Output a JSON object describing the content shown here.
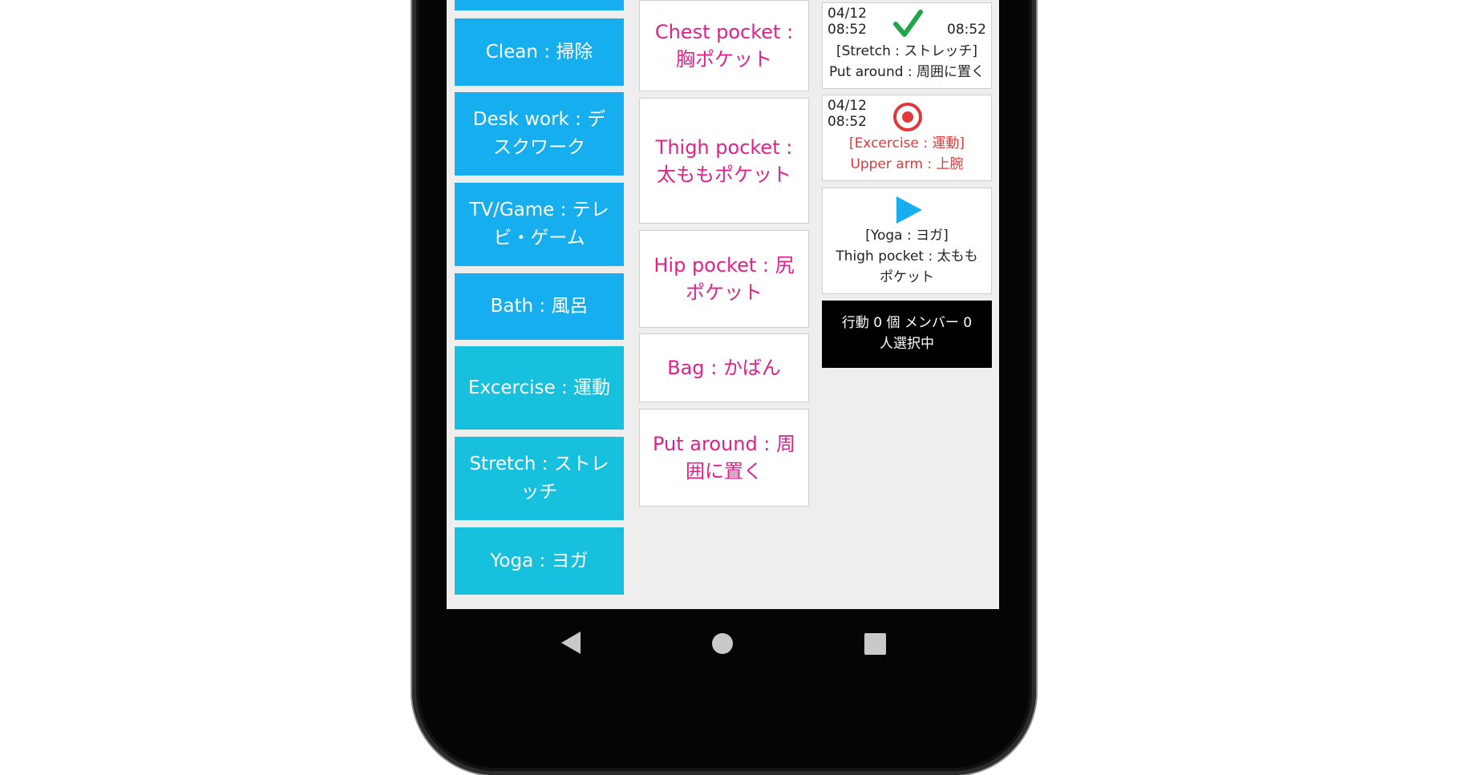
{
  "activities": [
    {
      "label": "",
      "color": "#16aeee"
    },
    {
      "label": "Clean : 掃除",
      "color": "#16aeee"
    },
    {
      "label": "Desk work : デスクワーク",
      "color": "#16aeee"
    },
    {
      "label": "TV/Game : テレビ・ゲーム",
      "color": "#16aeee"
    },
    {
      "label": "Bath : 風呂",
      "color": "#16aeee"
    },
    {
      "label": "Excercise : 運動",
      "color": "#17c0dc"
    },
    {
      "label": "Stretch : ストレッチ",
      "color": "#17c0dc"
    },
    {
      "label": "Yoga : ヨガ",
      "color": "#17c0dc"
    }
  ],
  "placements": [
    {
      "label": "Chest pocket : 胸ポケット"
    },
    {
      "label": "Thigh pocket : 太ももポケット"
    },
    {
      "label": "Hip pocket : 尻ポケット"
    },
    {
      "label": "Bag : かばん"
    },
    {
      "label": "Put around : 周囲に置く"
    }
  ],
  "records": [
    {
      "status_icon": "checkmark-icon",
      "date": "04/12",
      "start": "08:52",
      "end": "08:52",
      "activity": "[Stretch : ストレッチ]",
      "place": "Put around : 周囲に置く"
    },
    {
      "status_icon": "record-icon",
      "date": "04/12",
      "start": "08:52",
      "activity": "[Excercise : 運動]",
      "place": "Upper arm : 上腕"
    },
    {
      "status_icon": "play-icon",
      "activity": "[Yoga : ヨガ]",
      "place": "Thigh pocket : 太ももポケット"
    }
  ],
  "status": {
    "text": "行動 0 個 メンバー 0 人選択中"
  },
  "colors": {
    "accent_blue": "#16aeee",
    "accent_teal": "#17c0dc",
    "placement_text": "#e0218a",
    "recording_red": "#e0383b",
    "check_green": "#1fa64a"
  }
}
